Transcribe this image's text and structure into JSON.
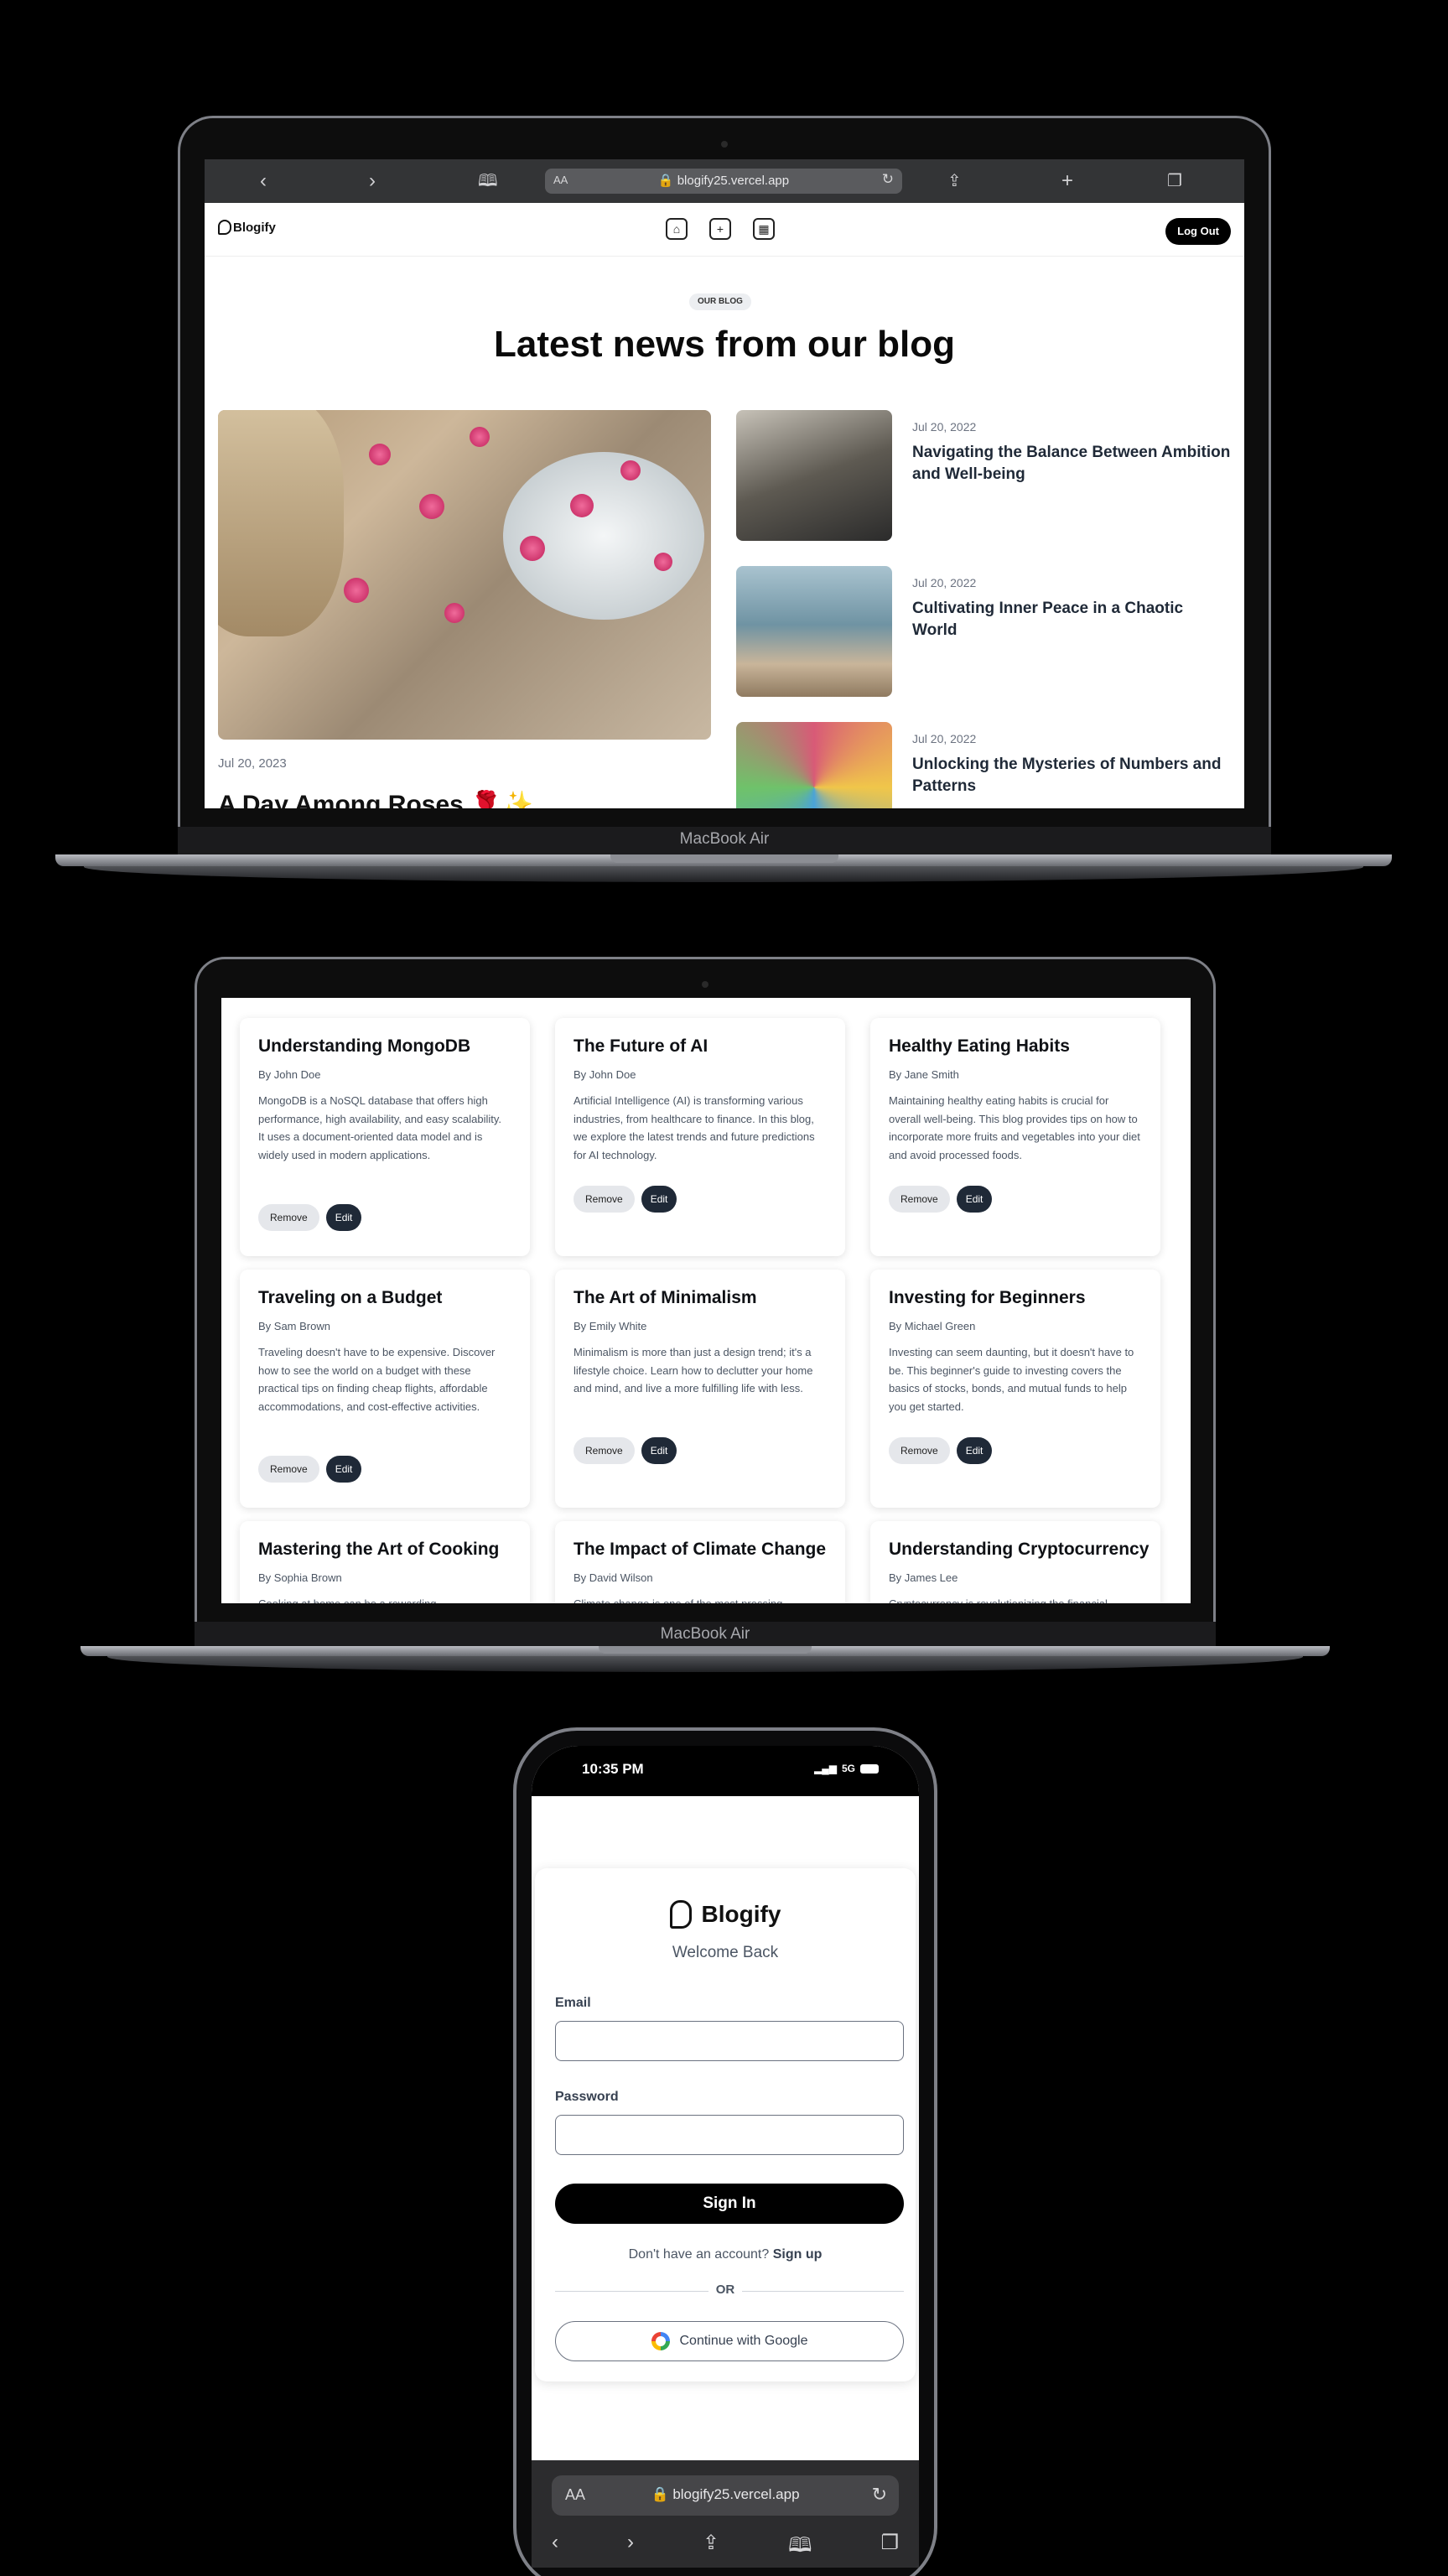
{
  "laptop1": {
    "device_label": "MacBook Air",
    "browser": {
      "back_icon": "chevron-left-icon",
      "forward_icon": "chevron-right-icon",
      "aa_label": "AA",
      "url": "🔒 blogify25.vercel.app",
      "back": "‹",
      "forward": "›",
      "book": "🕮",
      "reload": "↻",
      "share": "⇪",
      "add": "+",
      "tabs": "❐"
    },
    "site": {
      "brand": "Blogify",
      "logout_label": "Log Out",
      "chip": "OUR BLOG",
      "heading": "Latest news from our blog",
      "hero": {
        "date": "Jul 20, 2023",
        "title": "A Day Among Roses 🌹✨"
      },
      "side_posts": [
        {
          "date": "Jul 20, 2022",
          "title": "Navigating the Balance Between Ambition and Well-being",
          "color": "#5e5a52"
        },
        {
          "date": "Jul 20, 2022",
          "title": "Cultivating Inner Peace in a Chaotic World",
          "color": "#6f93a3"
        },
        {
          "date": "Jul 20, 2022",
          "title": "Unlocking the Mysteries of Numbers and Patterns",
          "color": "#d85a77"
        }
      ]
    }
  },
  "laptop2": {
    "device_label": "MacBook Air",
    "remove_label": "Remove",
    "edit_label": "Edit",
    "cards": [
      {
        "title": "Understanding MongoDB",
        "author": "By John Doe",
        "body": "MongoDB is a NoSQL database that offers high performance, high availability, and easy scalability. It uses a document-oriented data model and is widely used in modern applications."
      },
      {
        "title": "The Future of AI",
        "author": "By John Doe",
        "body": "Artificial Intelligence (AI) is transforming various industries, from healthcare to finance. In this blog, we explore the latest trends and future predictions for AI technology."
      },
      {
        "title": "Healthy Eating Habits",
        "author": "By Jane Smith",
        "body": "Maintaining healthy eating habits is crucial for overall well-being. This blog provides tips on how to incorporate more fruits and vegetables into your diet and avoid processed foods."
      },
      {
        "title": "Traveling on a Budget",
        "author": "By Sam Brown",
        "body": "Traveling doesn't have to be expensive. Discover how to see the world on a budget with these practical tips on finding cheap flights, affordable accommodations, and cost-effective activities."
      },
      {
        "title": "The Art of Minimalism",
        "author": "By Emily White",
        "body": "Minimalism is more than just a design trend; it's a lifestyle choice. Learn how to declutter your home and mind, and live a more fulfilling life with less."
      },
      {
        "title": "Investing for Beginners",
        "author": "By Michael Green",
        "body": "Investing can seem daunting, but it doesn't have to be. This beginner's guide to investing covers the basics of stocks, bonds, and mutual funds to help you get started."
      },
      {
        "title": "Mastering the Art of Cooking",
        "author": "By Sophia Brown",
        "body": "Cooking at home can be a rewarding"
      },
      {
        "title": "The Impact of Climate Change",
        "author": "By David Wilson",
        "body": "Climate change is one of the most pressing"
      },
      {
        "title": "Understanding Cryptocurrency",
        "author": "By James Lee",
        "body": "Cryptocurrency is revolutionizing the financial"
      }
    ]
  },
  "phone": {
    "time": "10:35 PM",
    "network": "5G",
    "brand": "Blogify",
    "welcome": "Welcome Back",
    "email_label": "Email",
    "password_label": "Password",
    "signin_label": "Sign In",
    "signup_prompt": "Don't have an account?",
    "signup_link": "Sign up",
    "or_label": "OR",
    "google_label": "Continue with Google",
    "aa_label": "AA",
    "url": "🔒 blogify25.vercel.app",
    "toolbar": {
      "back": "‹",
      "forward": "›",
      "share": "⇪",
      "book": "🕮",
      "tabs": "❐",
      "reload": "↻"
    }
  }
}
